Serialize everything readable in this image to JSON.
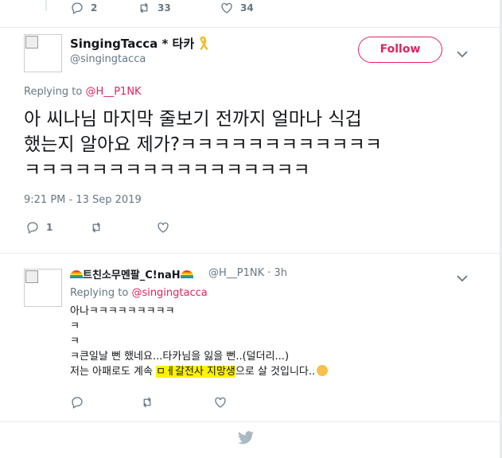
{
  "prev_tweet": {
    "reply_count": "2",
    "retweet_count": "33",
    "like_count": "34"
  },
  "tweet": {
    "display_name": "SingingTacca * 타카",
    "handle": "@singingtacca",
    "follow_label": "Follow",
    "replying_prefix": "Replying to ",
    "replying_to": "@H__P1NK",
    "text": "아 씨나님 마지막 줄보기 전까지 얼마나 식겁\n했는지 알아요 제가?ㅋㅋㅋㅋㅋㅋㅋㅋㅋㅋㅋㅋ\nㅋㅋㅋㅋㅋㅋㅋㅋㅋㅋㅋㅋㅋㅋㅋㅋㅋ",
    "timestamp": "9:21 PM - 13 Sep 2019",
    "reply_count": "1",
    "retweet_count": "",
    "like_count": ""
  },
  "reply": {
    "display_name": "트친소무멘팔_C!naH",
    "handle_time": "@H__P1NK · 3h",
    "replying_prefix": "Replying to ",
    "replying_to": "@singingtacca",
    "line1": "아나ㅋㅋㅋㅋㅋㅋㅋㅋㅋ",
    "line2": "ㅋ",
    "line3": "ㅋ",
    "line4": "ㅋ큰일날 뻔 했네요...타카님을 잃을 뻔..(덜더리...)",
    "line5_pre": "저는 아패로도 계속 ",
    "line5_hl": "ㅁㅔ갈전사 지망생",
    "line5_post": "으로 살 것입니다..",
    "reply_count": "",
    "retweet_count": "",
    "like_count": ""
  },
  "colors": {
    "accent": "#e0245e",
    "muted": "#657786",
    "text": "#14171a",
    "divider": "#e6ecf0",
    "twitter_blue": "#1da1f2"
  },
  "icons": {
    "reply": "reply-icon",
    "retweet": "retweet-icon",
    "like": "heart-icon",
    "more": "chevron-down-icon",
    "ribbon": "yellow-ribbon-icon",
    "rainbow": "rainbow-icon",
    "emoji": "smiling-face-icon",
    "bird": "twitter-bird-icon"
  }
}
